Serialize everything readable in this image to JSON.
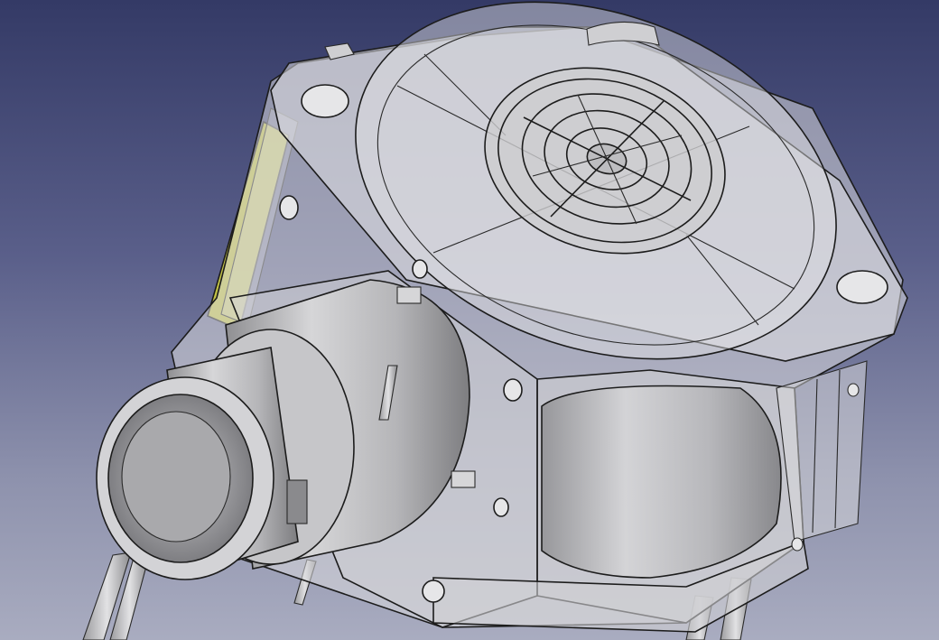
{
  "viewport": {
    "background_top": "#343a66",
    "background_bottom": "#a9acc0"
  },
  "model": {
    "body_color": "#c7c7c9",
    "transparent_shell_color": "#d9d9dc",
    "selected_face_color": "#d4d43a",
    "edge_color": "#1c1c1c"
  }
}
